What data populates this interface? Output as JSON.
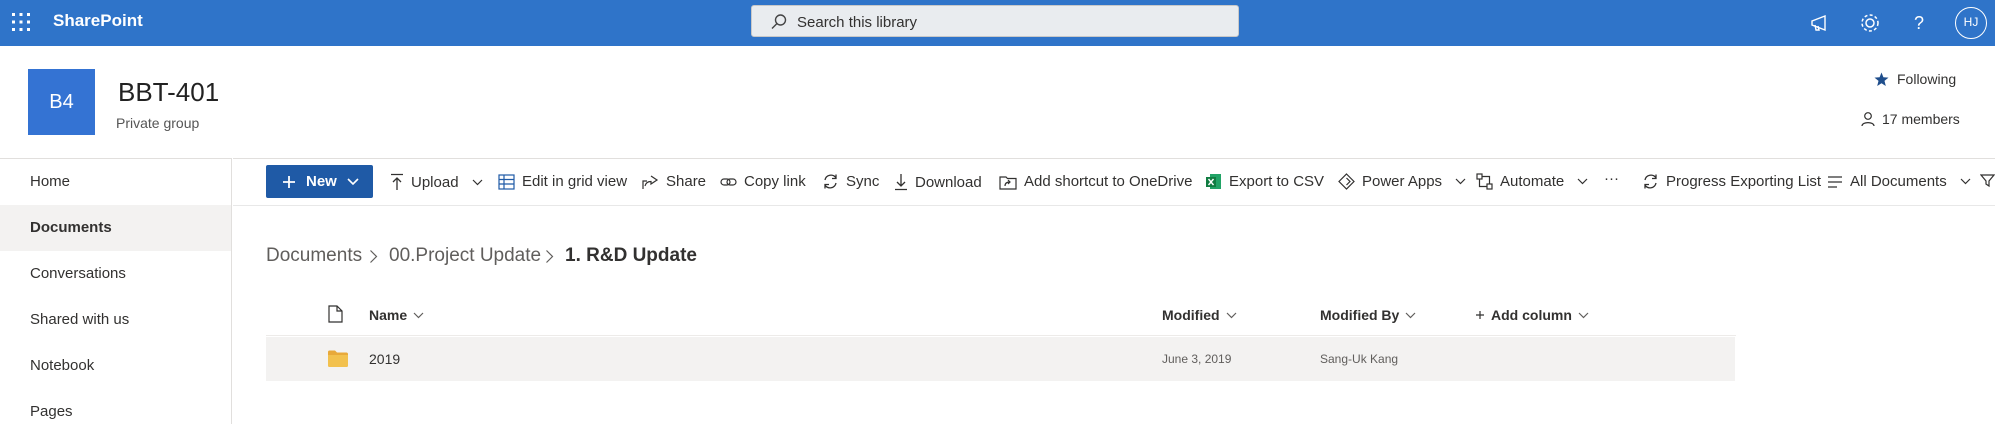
{
  "suite": {
    "brand": "SharePoint",
    "search_placeholder": "Search this library",
    "avatar_initials": "HJ"
  },
  "site": {
    "logo_text": "B4",
    "title": "BBT-401",
    "subtitle": "Private group",
    "following_label": "Following",
    "members_label": "17 members"
  },
  "nav": {
    "items": [
      {
        "label": "Home"
      },
      {
        "label": "Documents"
      },
      {
        "label": "Conversations"
      },
      {
        "label": "Shared with us"
      },
      {
        "label": "Notebook"
      },
      {
        "label": "Pages"
      }
    ],
    "selected": "Documents"
  },
  "commands": {
    "new": "New",
    "upload": "Upload",
    "edit_grid": "Edit in grid view",
    "share": "Share",
    "copy_link": "Copy link",
    "sync": "Sync",
    "download": "Download",
    "add_shortcut": "Add shortcut to OneDrive",
    "export_csv": "Export to CSV",
    "power_apps": "Power Apps",
    "automate": "Automate",
    "more": "···",
    "progress_export": "Progress Exporting List",
    "view": "All Documents"
  },
  "breadcrumb": {
    "items": [
      "Documents",
      "00.Project Update",
      "1. R&D Update"
    ]
  },
  "list": {
    "columns": {
      "name": "Name",
      "modified": "Modified",
      "modified_by": "Modified By",
      "add_column": "Add column"
    },
    "rows": [
      {
        "type": "folder",
        "name": "2019",
        "modified": "June 3, 2019",
        "modified_by": "Sang-Uk Kang"
      }
    ]
  },
  "colors": {
    "suite_bar": "#2f74c9",
    "new_button": "#1f5aa6",
    "site_logo": "#3473d3",
    "folder": "#f2c14e"
  }
}
